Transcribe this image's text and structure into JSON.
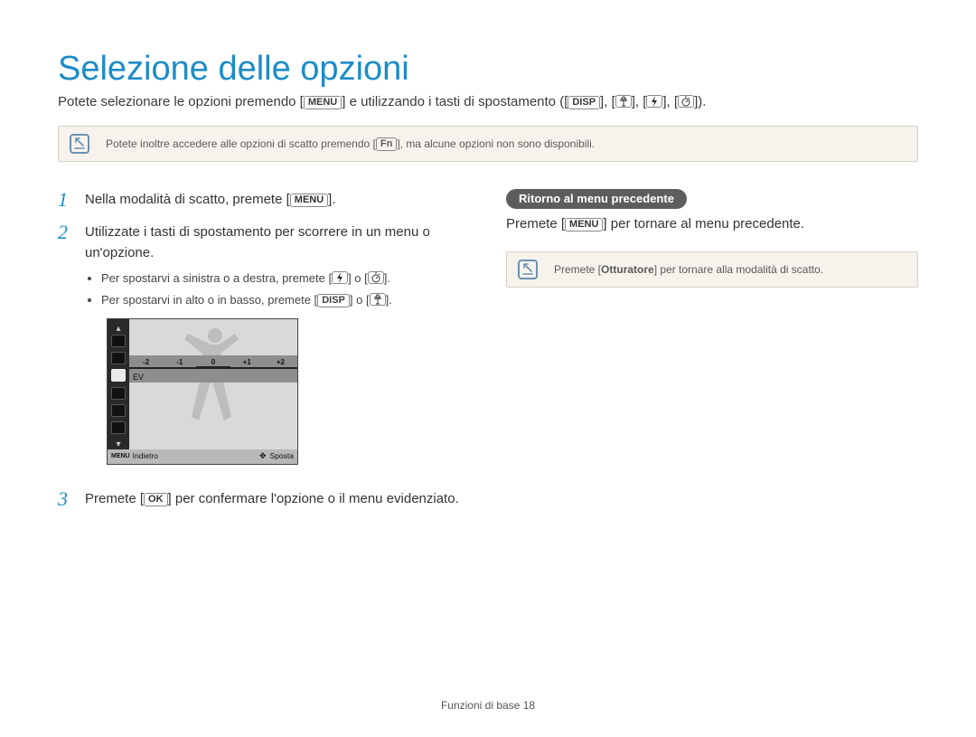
{
  "title": "Selezione delle opzioni",
  "subtitle_before": "Potete selezionare le opzioni premendo [",
  "subtitle_mid": "] e utilizzando i tasti di spostamento ([",
  "subtitle_end": "]).",
  "btn": {
    "menu": "MENU",
    "disp": "DISP",
    "fn": "Fn",
    "ok": "OK"
  },
  "note1_before": "Potete inoltre accedere alle opzioni di scatto premendo [",
  "note1_after": "], ma alcune opzioni non sono disponibili.",
  "steps": {
    "s1_before": "Nella modalità di scatto, premete [",
    "s1_after": "].",
    "s2": "Utilizzate i tasti di spostamento per scorrere in un menu o un'opzione.",
    "s2_b1_before": "Per spostarvi a sinistra o a destra, premete [",
    "s2_b1_mid": "] o [",
    "s2_b1_after": "].",
    "s2_b2_before": "Per spostarvi in alto o in basso, premete [",
    "s2_b2_mid": "] o [",
    "s2_b2_after": "].",
    "s3_before": "Premete [",
    "s3_after": "] per confermare l'opzione o il menu evidenziato."
  },
  "figure": {
    "ev": "EV",
    "ticks": [
      "-2",
      "-1",
      "0",
      "+1",
      "+2"
    ],
    "footer_back_label": "Indietro",
    "footer_move_label": "Sposta",
    "footer_menu": "MENU"
  },
  "right": {
    "heading": "Ritorno al menu precedente",
    "p_before": "Premete [",
    "p_after": "] per tornare al menu precedente.",
    "note_before": "Premete [",
    "note_bold": "Otturatore",
    "note_after": "] per tornare alla modalità di scatto."
  },
  "footer": {
    "section": "Funzioni di base ",
    "page": "18"
  }
}
